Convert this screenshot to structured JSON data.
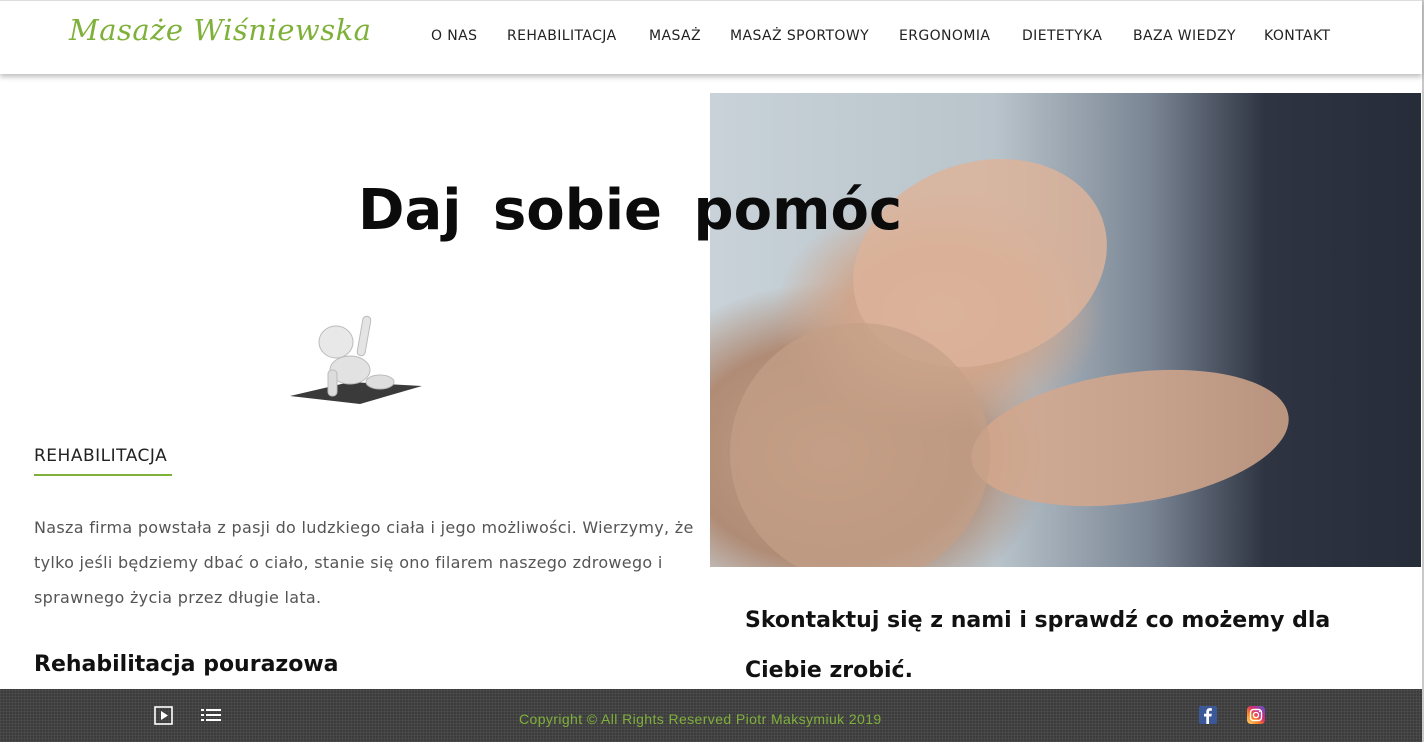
{
  "header": {
    "logo": "Masaże Wiśniewska",
    "nav": [
      "O NAS",
      "REHABILITACJA",
      "MASAŻ",
      "MASAŻ SPORTOWY",
      "ERGONOMIA",
      "DIETETYKA",
      "BAZA WIEDZY",
      "KONTAKT"
    ]
  },
  "hero": {
    "headline": "Daj  sobie  pomóc"
  },
  "section": {
    "label": "REHABILITACJA",
    "body": "Nasza firma powstała z pasji do ludzkiego ciała i jego możliwości. Wierzymy, że tylko jeśli będziemy dbać o ciało, stanie się ono filarem naszego zdrowego i sprawnego życia przez długie lata.",
    "subheading": "Rehabilitacja pourazowa"
  },
  "cta": {
    "text": "Skontaktuj się z nami i sprawdź co możemy dla Ciebie zrobić."
  },
  "footer": {
    "copyright": "Copyright © All Rights Reserved Piotr Maksymiuk 2019",
    "icons": [
      "play-icon",
      "list-icon",
      "facebook-icon",
      "instagram-icon"
    ]
  },
  "colors": {
    "accent": "#7fb13a",
    "footer_bg": "#3c3c3c",
    "text": "#222222"
  }
}
